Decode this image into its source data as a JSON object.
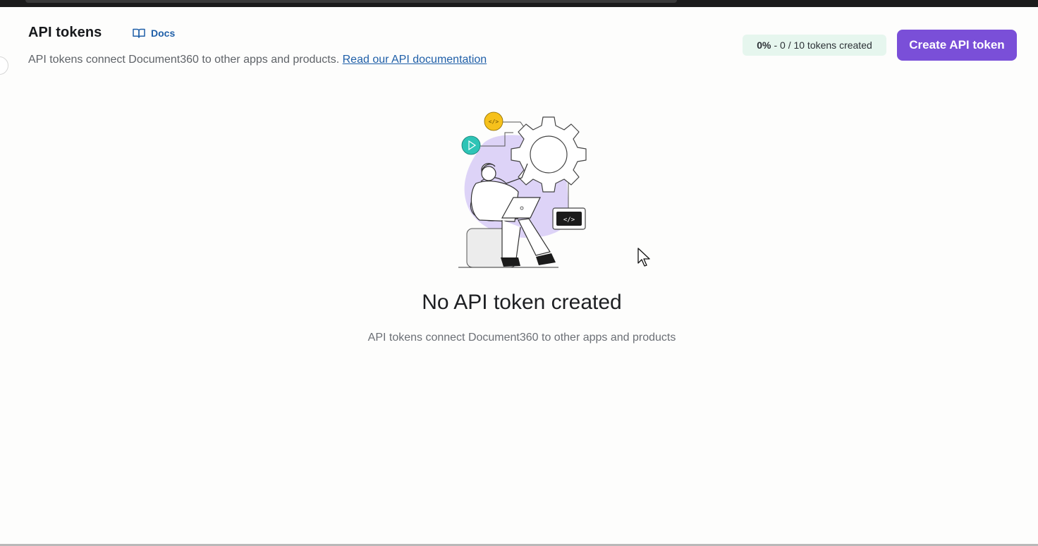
{
  "header": {
    "title": "API tokens",
    "docs_label": "Docs",
    "subtitle": "API tokens connect Document360 to other apps and products.",
    "doc_link_label": "Read our API documentation"
  },
  "usage": {
    "percent": "0%",
    "separator": " - ",
    "count_text": "0 / 10 tokens created"
  },
  "actions": {
    "create_label": "Create API token"
  },
  "empty_state": {
    "title": "No API token created",
    "description": "API tokens connect Document360 to other apps and products"
  },
  "icons": [
    "book-icon",
    "gear-icon",
    "code-badge-icon",
    "play-badge-icon",
    "terminal-icon",
    "pointer-cursor-icon"
  ],
  "colors": {
    "accent": "#7a4fd8",
    "link": "#1f5fa8",
    "badge_bg": "#e6f6ee",
    "illustration_purple": "#ddd3f7",
    "illustration_yellow": "#f6c11c",
    "illustration_teal": "#2ec4b6"
  }
}
